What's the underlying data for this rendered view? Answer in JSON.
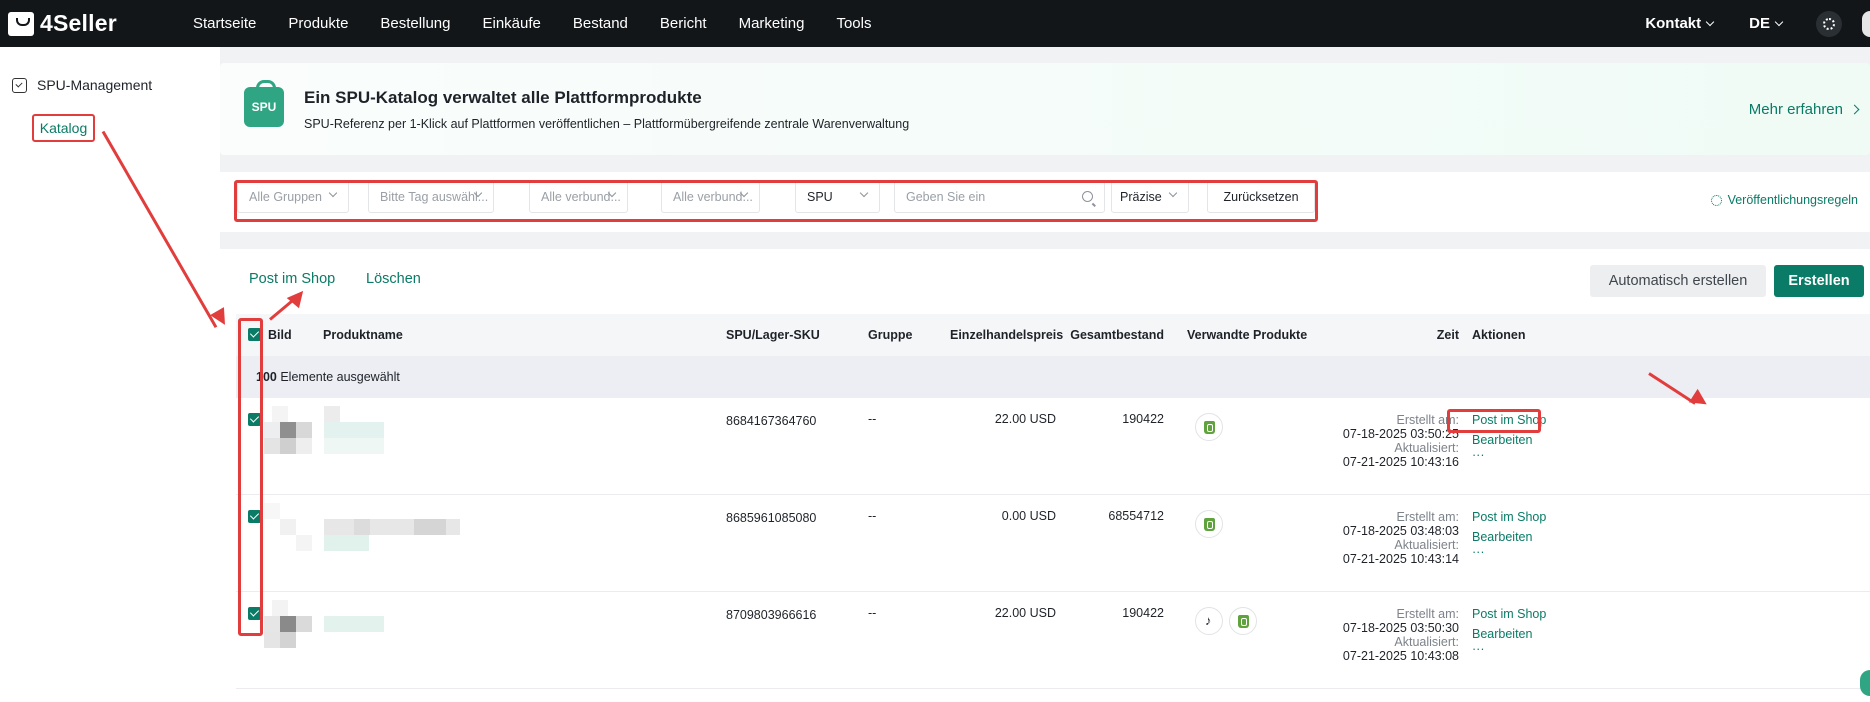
{
  "app": {
    "logo_text": "4Seller"
  },
  "nav": {
    "items": [
      "Startseite",
      "Produkte",
      "Bestellung",
      "Einkäufe",
      "Bestand",
      "Bericht",
      "Marketing",
      "Tools"
    ],
    "contact": "Kontakt",
    "language": "DE"
  },
  "sidebar": {
    "section": "SPU-Management",
    "item": "Katalog"
  },
  "banner": {
    "badge": "SPU",
    "title": "Ein SPU-Katalog verwaltet alle Plattformprodukte",
    "subtitle": "SPU-Referenz per 1-Klick auf Plattformen veröffentlichen – Plattformübergreifende zentrale Warenverwaltung",
    "more": "Mehr erfahren"
  },
  "filters": {
    "groups": "Alle Gruppen",
    "tag": "Bitte Tag auswähl...",
    "linked1": "Alle verbund...",
    "linked2": "Alle verbund...",
    "field": "SPU",
    "search_placeholder": "Geben Sie ein",
    "match": "Präzise",
    "reset": "Zurücksetzen",
    "publish_rules": "Veröffentlichungsregeln"
  },
  "actions": {
    "post": "Post im Shop",
    "delete": "Löschen",
    "auto_create": "Automatisch erstellen",
    "create": "Erstellen"
  },
  "table": {
    "headers": {
      "image": "Bild",
      "name": "Produktname",
      "sku": "SPU/Lager-SKU",
      "group": "Gruppe",
      "price": "Einzelhandelspreis",
      "stock": "Gesamtbestand",
      "related": "Verwandte Produkte",
      "time": "Zeit",
      "actions": "Aktionen"
    },
    "selection": {
      "count": "100",
      "text": "Elemente ausgewählt"
    },
    "row_labels": {
      "created": "Erstellt am:",
      "updated": "Aktualisiert:",
      "post": "Post im Shop",
      "edit": "Bearbeiten",
      "more": "···"
    },
    "rows": [
      {
        "sku": "8684167364760",
        "group": "--",
        "price": "22.00 USD",
        "stock": "190422",
        "platforms": [
          "shopify"
        ],
        "created": "07-18-2025 03:50:25",
        "updated": "07-21-2025 10:43:16"
      },
      {
        "sku": "8685961085080",
        "group": "--",
        "price": "0.00 USD",
        "stock": "68554712",
        "platforms": [
          "shopify"
        ],
        "created": "07-18-2025 03:48:03",
        "updated": "07-21-2025 10:43:14"
      },
      {
        "sku": "8709803966616",
        "group": "--",
        "price": "22.00 USD",
        "stock": "190422",
        "platforms": [
          "tiktok",
          "shopify"
        ],
        "created": "07-18-2025 03:50:30",
        "updated": "07-21-2025 10:43:08"
      }
    ]
  },
  "colors": {
    "accent": "#0a7b66",
    "annotation": "#e23d3d",
    "topbar": "#121619"
  }
}
